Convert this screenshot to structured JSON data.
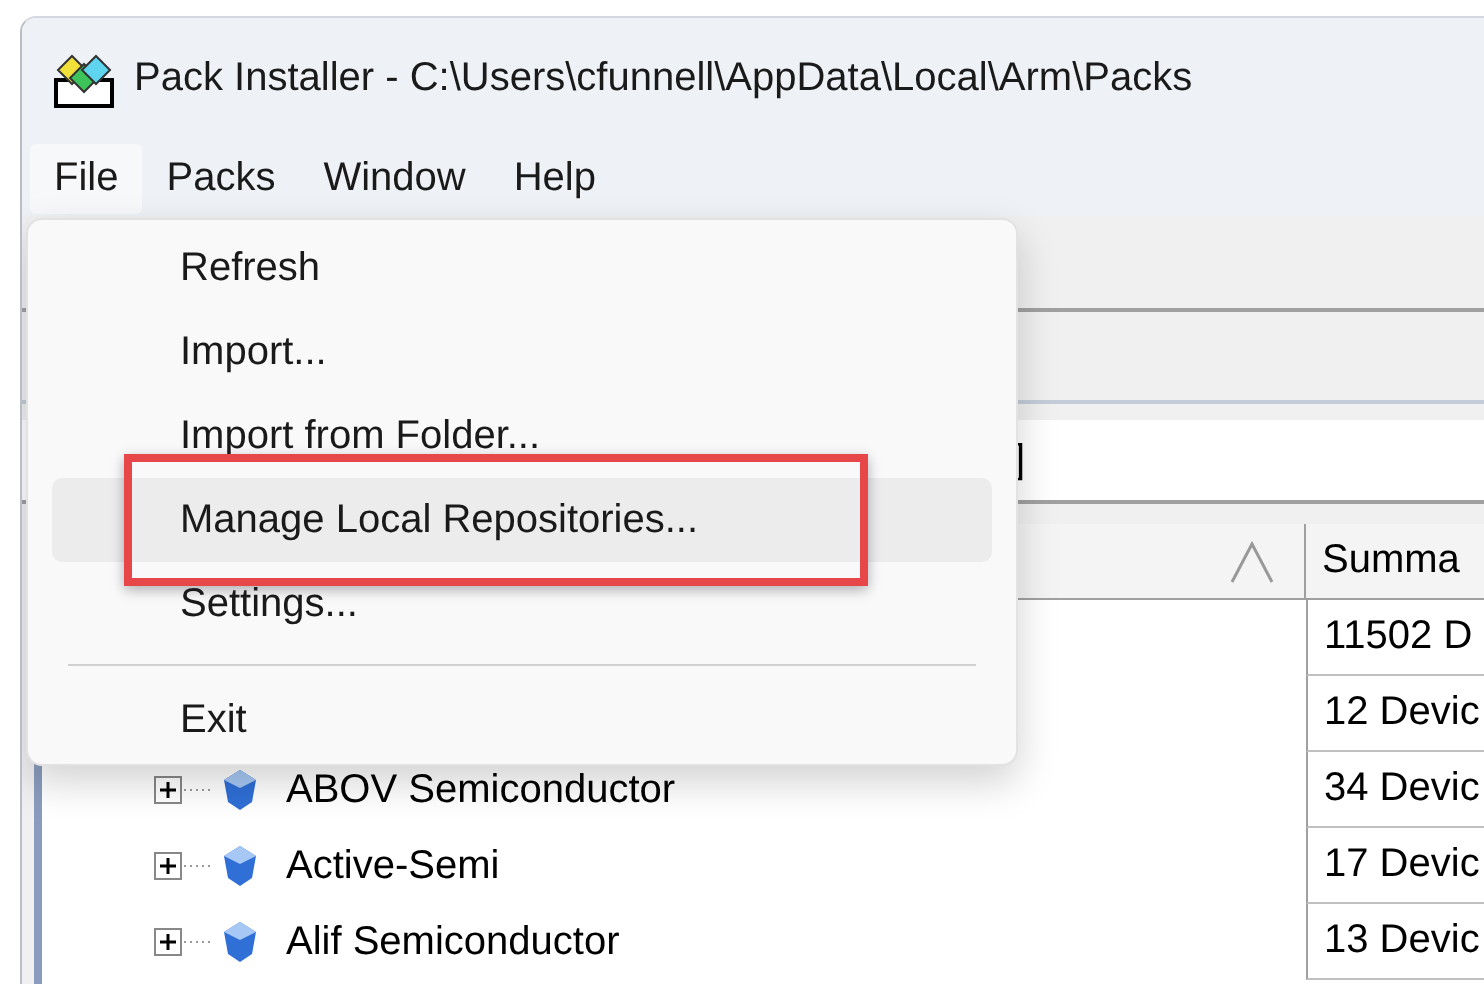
{
  "window": {
    "title": "Pack Installer - C:\\Users\\cfunnell\\AppData\\Local\\Arm\\Packs"
  },
  "menubar": [
    {
      "label": "File",
      "selected": true
    },
    {
      "label": "Packs",
      "selected": false
    },
    {
      "label": "Window",
      "selected": false
    },
    {
      "label": "Help",
      "selected": false
    }
  ],
  "file_menu": {
    "items": [
      {
        "kind": "item",
        "label": "Refresh",
        "highlighted": false,
        "annotated": false
      },
      {
        "kind": "item",
        "label": "Import...",
        "highlighted": false,
        "annotated": false
      },
      {
        "kind": "item",
        "label": "Import from Folder...",
        "highlighted": false,
        "annotated": false
      },
      {
        "kind": "item",
        "label": "Manage Local Repositories...",
        "highlighted": true,
        "annotated": true
      },
      {
        "kind": "item",
        "label": "Settings...",
        "highlighted": false,
        "annotated": false
      },
      {
        "kind": "separator"
      },
      {
        "kind": "item",
        "label": "Exit",
        "highlighted": false,
        "annotated": false
      }
    ]
  },
  "filter_field": {
    "value": "]"
  },
  "table": {
    "columns": [
      {
        "sorted": true
      },
      {
        "label": "Summa"
      }
    ],
    "rows": [
      {
        "summary": "11502 D"
      },
      {
        "summary": "12 Devic"
      },
      {
        "name": "ABOV Semiconductor",
        "summary": "34 Devic",
        "expanded": false
      },
      {
        "name": "Active-Semi",
        "summary": "17 Devic",
        "expanded": false
      },
      {
        "name": "Alif Semiconductor",
        "summary": "13 Devic",
        "expanded": false
      }
    ]
  }
}
